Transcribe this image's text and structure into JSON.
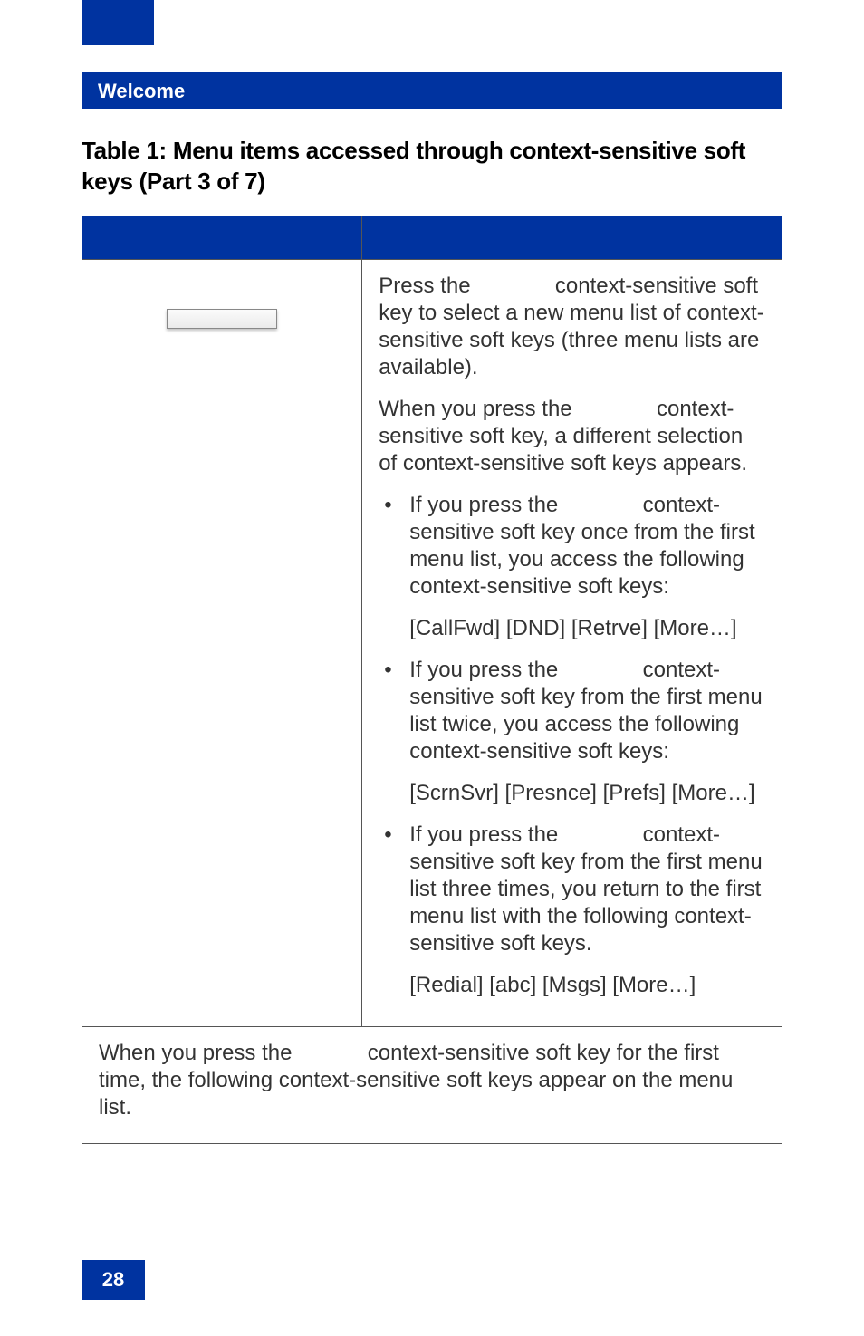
{
  "section_header": "Welcome",
  "table_title": "Table 1: Menu items accessed through context-sensitive soft keys (Part 3 of 7)",
  "chart_data": {
    "type": "table",
    "caption": "Table 1: Menu items accessed through context-sensitive soft keys (Part 3 of 7)",
    "rows": [
      {
        "left": "(soft key graphic)",
        "right": [
          "Press the context-sensitive soft key to select a new menu list of context-sensitive soft keys (three menu lists are available).",
          "When you press the context-sensitive soft key, a different selection of context-sensitive soft keys appears.",
          {
            "bullet": "If you press the context-sensitive soft key once from the first menu list, you access the following context-sensitive soft keys:",
            "line": "[CallFwd] [DND] [Retrve] [More…]"
          },
          {
            "bullet": "If you press the context-sensitive soft key from the first menu list twice, you access the following context-sensitive soft keys:",
            "line": "[ScrnSvr] [Presnce] [Prefs] [More…]"
          },
          {
            "bullet": "If you press the context-sensitive soft key from the first menu list three times, you return to the first menu list with the following context-sensitive soft keys.",
            "line": "[Redial] [abc] [Msgs] [More…]"
          }
        ]
      }
    ],
    "footnote": "When you press the context-sensitive soft key for the first time, the following context-sensitive soft keys appear on the menu list."
  },
  "row1": {
    "p1_a": " Press the ",
    "p1_b": " context-sensitive soft key to select a new menu list of context-sensitive soft keys (three menu lists are available).",
    "p2_a": "When you press the ",
    "p2_b": " context-sensitive soft key, a different selection of context-sensitive soft keys appears.",
    "b1_a": "If you press the ",
    "b1_b": " context-sensitive soft key once from the first menu list, you access the following context-sensitive soft keys:",
    "s1": "[CallFwd] [DND] [Retrve] [More…]",
    "b2_a": "If you press the ",
    "b2_b": " context-sensitive soft key from the first menu list twice, you access the following context-sensitive soft keys:",
    "s2": "[ScrnSvr] [Presnce] [Prefs] [More…]",
    "b3_a": "If you press the ",
    "b3_b": " context-sensitive soft key from the first menu list three times, you return to the first menu list with the following context-sensitive soft keys.",
    "s3": "[Redial] [abc] [Msgs] [More…]"
  },
  "footrow_a": "When you press the ",
  "footrow_b": " context-sensitive soft key for the first time, the following context-sensitive soft keys appear on the menu list.",
  "page_number": "28"
}
